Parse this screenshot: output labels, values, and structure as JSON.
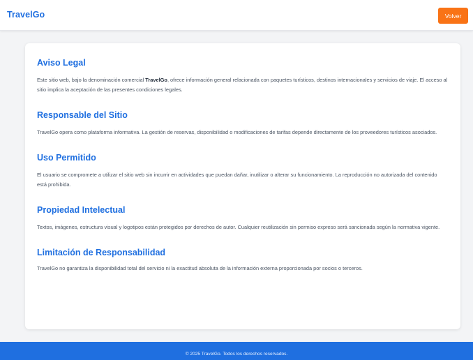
{
  "header": {
    "brand": "TravelGo",
    "back_button": "Volver"
  },
  "sections": [
    {
      "title": "Aviso Legal",
      "text_before": "Este sitio web, bajo la denominación comercial ",
      "text_bold": "TravelGo",
      "text_after": ", ofrece información general relacionada con paquetes turísticos, destinos internacionales y servicios de viaje. El acceso al sitio implica la aceptación de las presentes condiciones legales."
    },
    {
      "title": "Responsable del Sitio",
      "text": "TravelGo opera como plataforma informativa. La gestión de reservas, disponibilidad o modificaciones de tarifas depende directamente de los proveedores turísticos asociados."
    },
    {
      "title": "Uso Permitido",
      "text": "El usuario se compromete a utilizar el sitio web sin incurrir en actividades que puedan dañar, inutilizar o alterar su funcionamiento. La reproducción no autorizada del contenido está prohibida."
    },
    {
      "title": "Propiedad Intelectual",
      "text": "Textos, imágenes, estructura visual y logotipos están protegidos por derechos de autor. Cualquier reutilización sin permiso expreso será sancionada según la normativa vigente."
    },
    {
      "title": "Limitación de Responsabilidad",
      "text": "TravelGo no garantiza la disponibilidad total del servicio ni la exactitud absoluta de la información externa proporcionada por socios o terceros."
    }
  ],
  "footer": {
    "text": "© 2025 TravelGo. Todos los derechos reservados."
  },
  "colors": {
    "brand_blue": "#1f6fe0",
    "button_orange": "#f97316",
    "page_background": "#f3f4f6"
  }
}
